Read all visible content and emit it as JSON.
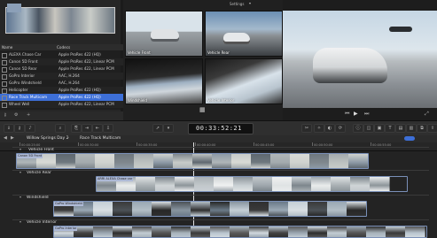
{
  "viewer": {
    "settings_label": "Settings",
    "angles": [
      {
        "label": "Vehicle Front"
      },
      {
        "label": "Vehicle Rear"
      },
      {
        "label": "Windshield"
      },
      {
        "label": "Vehicle Interior"
      }
    ],
    "timecode": "00:33:52:21"
  },
  "browser": {
    "columns": {
      "name": "Name",
      "codecs": "Codecs"
    },
    "rows": [
      {
        "name": "ALEXA Chase Car",
        "codec": "Apple ProRes 422 (HQ)",
        "selected": false
      },
      {
        "name": "Canon 5D Front",
        "codec": "Apple ProRes 422, Linear PCM",
        "selected": false
      },
      {
        "name": "Canon 5D Rear",
        "codec": "Apple ProRes 422, Linear PCM",
        "selected": false
      },
      {
        "name": "GoPro Interior",
        "codec": "AAC, H.264",
        "selected": false
      },
      {
        "name": "GoPro Windshield",
        "codec": "AAC, H.264",
        "selected": false
      },
      {
        "name": "Helicopter",
        "codec": "Apple ProRes 422 (HQ)",
        "selected": false
      },
      {
        "name": "Race Track Multicam",
        "codec": "Apple ProRes 422 (HQ)",
        "selected": true
      },
      {
        "name": "Wheel Well",
        "codec": "Apple ProRes 422, Linear PCM",
        "selected": false
      }
    ],
    "selection_status": "1 of 8 sel..."
  },
  "timeline": {
    "breadcrumb": [
      "Willow Springs Day 2",
      "Race Track Multicam"
    ],
    "ruler": [
      "00:00:25:00",
      "00:00:30:00",
      "00:00:35:00",
      "00:00:40:00",
      "00:00:45:00",
      "00:00:50:00",
      "00:00:55:00"
    ],
    "tracks": [
      {
        "name": "Vehicle Front",
        "clip": "Canon 5D Front"
      },
      {
        "name": "Vehicle Rear",
        "clip": "ARRI ALEXA Chase car"
      },
      {
        "name": "Windshield",
        "clip": "GoPro Windshield"
      },
      {
        "name": "Vehicle Interior",
        "clip": "GoPro Interior"
      }
    ]
  },
  "colors": {
    "accent": "#3d6fd8",
    "track_border": "#7a90b8",
    "selected_row": "#3d6fd8"
  }
}
